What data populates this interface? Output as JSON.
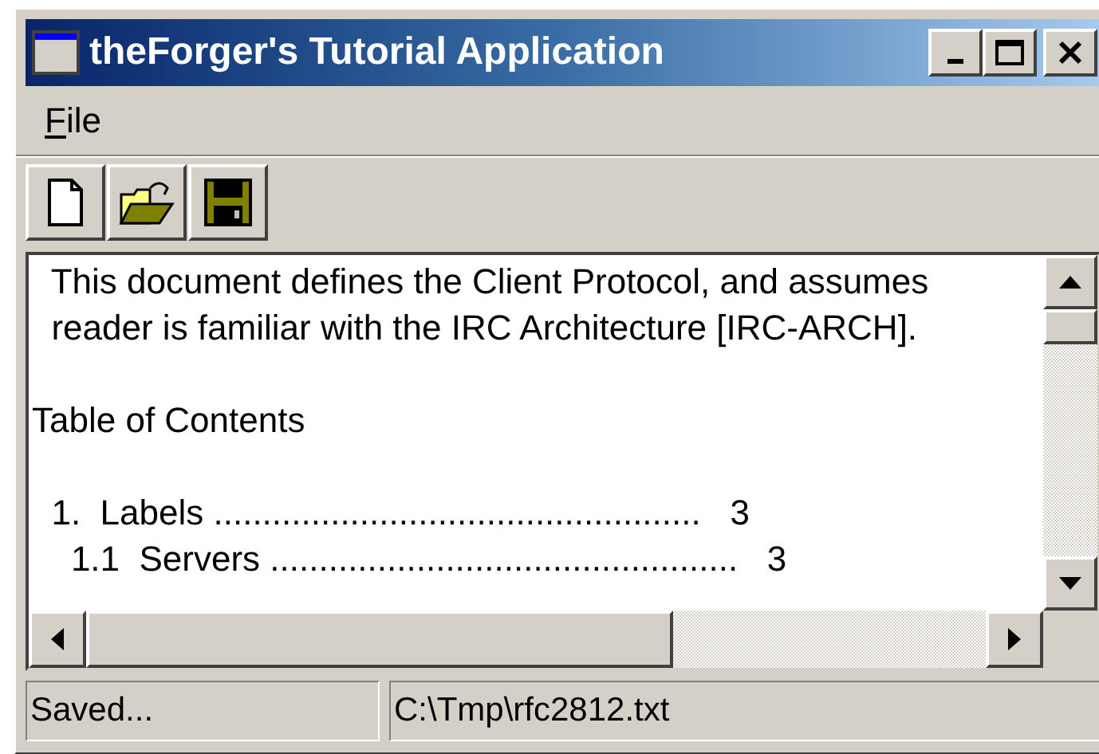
{
  "window": {
    "title": "theForger's Tutorial Application"
  },
  "menu": [
    {
      "label": "File"
    }
  ],
  "editor": {
    "paragraphs": [
      [
        "  This document defines the Client Protocol, and assumes",
        "  reader is familiar with the IRC Architecture [IRC-ARCH]."
      ],
      [
        "Table of Contents"
      ],
      [
        "  1.  Labels ..................................................   3",
        "    1.1  Servers ................................................   3"
      ]
    ]
  },
  "status_bar": [
    "Saved...",
    "C:\\Tmp\\rfc2812.txt"
  ]
}
